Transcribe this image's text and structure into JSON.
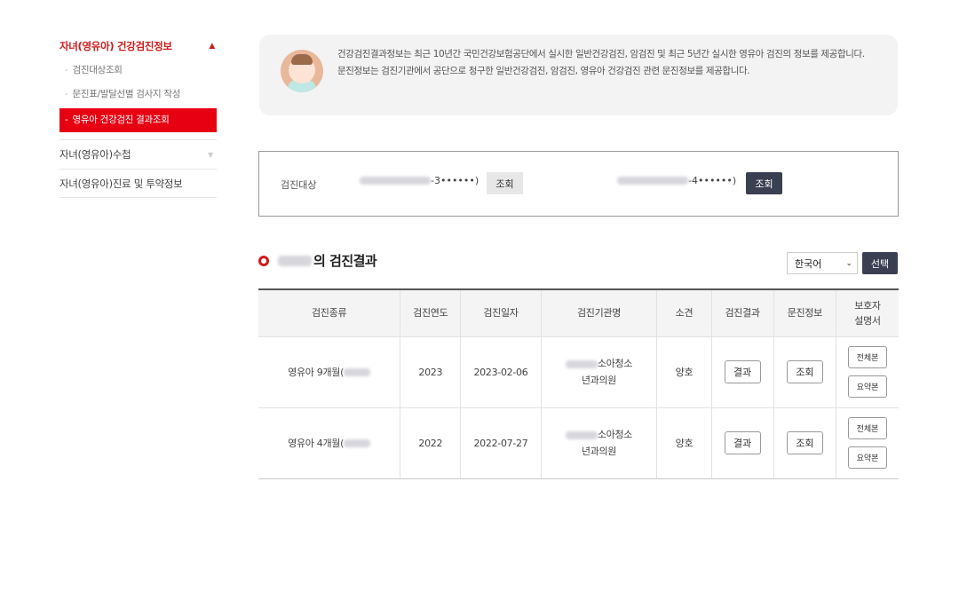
{
  "sidebar": {
    "header": "자녀(영유아) 건강검진정보",
    "header_arrow": "▲",
    "sub_items": [
      {
        "label": "검진대상조회"
      },
      {
        "label": "문진표/발달선별 검사지 작성"
      },
      {
        "label": "영유아 건강검진 결과조회"
      }
    ],
    "dash": "-",
    "items": [
      {
        "label": "자녀(영유아)수첩",
        "arrow": "▼"
      },
      {
        "label": "자녀(영유아)진료 및 투약정보"
      }
    ]
  },
  "info": {
    "line1": "건강검진결과정보는 최근 10년간 국민건강보험공단에서 실시한 일반건강검진, 암검진 및 최근 5년간 실시한 영유아 검진의 정보를 제공합니다.",
    "line2": "문진정보는 검진기관에서 공단으로 청구한 일반건강검진, 암검진, 영유아 건강검진 관련 문진정보를 제공합니다."
  },
  "target": {
    "label": "검진대상",
    "child1_suffix": "-3••••••)",
    "child2_suffix": "-4••••••)",
    "btn_label": "조회"
  },
  "result": {
    "title_suffix": "의 검진결과",
    "language": "한국어",
    "select_btn": "선택"
  },
  "table": {
    "headers": [
      "검진종류",
      "검진연도",
      "검진일자",
      "검진기관명",
      "소견",
      "검진결과",
      "문진정보",
      "보호자\n설명서"
    ],
    "rows": [
      {
        "type": "영유아 9개월(",
        "year": "2023",
        "date": "2023-02-06",
        "org1": "소아청소",
        "org2": "년과의원",
        "opinion": "양호",
        "result_btn": "결과",
        "inquiry_btn": "조회",
        "full_btn": "전체본",
        "summary_btn": "요약본"
      },
      {
        "type": "영유아 4개월(",
        "year": "2022",
        "date": "2022-07-27",
        "org1": "소아청소",
        "org2": "년과의원",
        "opinion": "양호",
        "result_btn": "결과",
        "inquiry_btn": "조회",
        "full_btn": "전체본",
        "summary_btn": "요약본"
      }
    ]
  }
}
